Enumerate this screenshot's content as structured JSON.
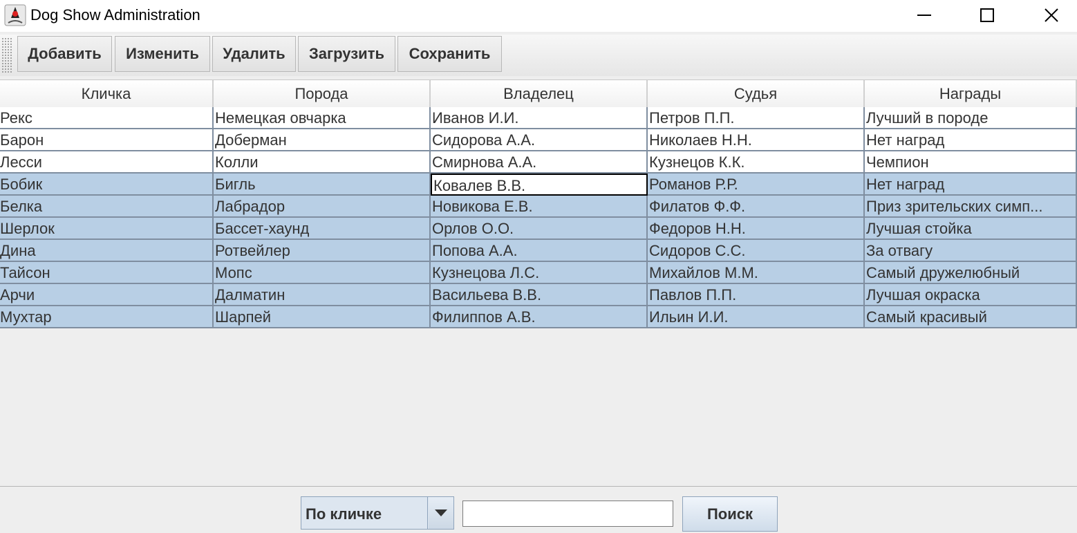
{
  "window": {
    "title": "Dog Show Administration",
    "icon": "java-duke-icon"
  },
  "toolbar": {
    "add_label": "Добавить",
    "edit_label": "Изменить",
    "delete_label": "Удалить",
    "load_label": "Загрузить",
    "save_label": "Сохранить"
  },
  "table": {
    "columns": [
      "Кличка",
      "Порода",
      "Владелец",
      "Судья",
      "Награды"
    ],
    "rows": [
      [
        "Рекс",
        "Немецкая овчарка",
        "Иванов И.И.",
        "Петров П.П.",
        "Лучший в породе"
      ],
      [
        "Барон",
        "Доберман",
        "Сидорова А.А.",
        "Николаев Н.Н.",
        "Нет наград"
      ],
      [
        "Лесси",
        "Колли",
        "Смирнова А.А.",
        "Кузнецов К.К.",
        "Чемпион"
      ],
      [
        "Бобик",
        "Бигль",
        "Ковалев В.В.",
        "Романов Р.Р.",
        "Нет наград"
      ],
      [
        "Белка",
        "Лабрадор",
        "Новикова Е.В.",
        "Филатов Ф.Ф.",
        "Приз зрительских симп..."
      ],
      [
        "Шерлок",
        "Бассет-хаунд",
        "Орлов О.О.",
        "Федоров Н.Н.",
        "Лучшая стойка"
      ],
      [
        "Дина",
        "Ротвейлер",
        "Попова А.А.",
        "Сидоров С.С.",
        "За отвагу"
      ],
      [
        "Тайсон",
        "Мопс",
        "Кузнецова Л.С.",
        "Михайлов М.М.",
        "Самый дружелюбный"
      ],
      [
        "Арчи",
        "Далматин",
        "Васильева В.В.",
        "Павлов П.П.",
        "Лучшая окраска"
      ],
      [
        "Мухтар",
        "Шарпей",
        "Филиппов А.В.",
        "Ильин И.И.",
        "Самый красивый"
      ]
    ]
  },
  "search": {
    "mode_value": "По кличке",
    "query_value": "",
    "button_label": "Поиск"
  },
  "colors": {
    "selected_row": "#b8cfe5",
    "grid": "#7f8ea0"
  }
}
